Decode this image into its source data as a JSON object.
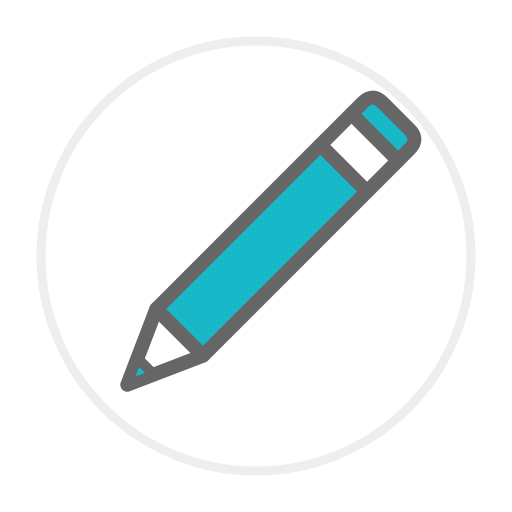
{
  "icon": {
    "name": "pencil-icon",
    "colors": {
      "ring": "#eeeeee",
      "outline": "#666666",
      "body": "#19b8c9",
      "band": "#ffffff",
      "background": "#ffffff"
    }
  }
}
